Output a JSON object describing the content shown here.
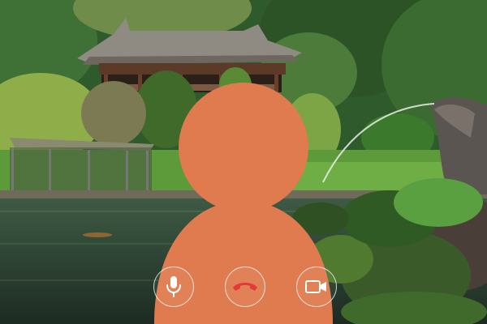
{
  "call": {
    "controls": [
      {
        "id": "microphone",
        "icon": "microphone-icon",
        "color": "#ffffff"
      },
      {
        "id": "end-call",
        "icon": "phone-hangup-icon",
        "color": "#e53935"
      },
      {
        "id": "camera",
        "icon": "video-camera-icon",
        "color": "#ffffff"
      }
    ]
  },
  "avatar": {
    "icon": "person-silhouette-icon",
    "color": "#e07b4f"
  },
  "background": {
    "description_icon": "garden-pavilion-scene"
  }
}
